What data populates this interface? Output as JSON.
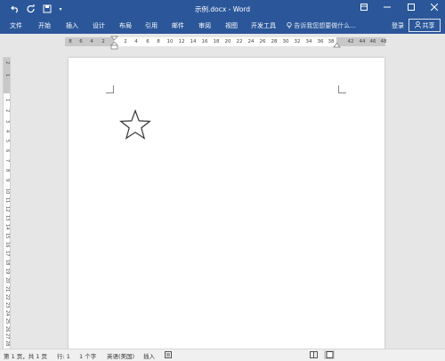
{
  "titlebar": {
    "title": "示例.docx - Word",
    "qa_undo_icon": "undo-icon",
    "qa_redo_icon": "redo-icon",
    "qa_save_icon": "save-icon",
    "qa_more": "▾"
  },
  "ribbon": {
    "tabs": [
      "文件",
      "开始",
      "插入",
      "设计",
      "布局",
      "引用",
      "邮件",
      "审阅",
      "视图",
      "开发工具"
    ],
    "tell_me": "告诉我您想要做什么...",
    "login": "登录",
    "share": "共享"
  },
  "ruler": {
    "left_ticks": [
      "8",
      "6",
      "4",
      "2"
    ],
    "right_ticks": [
      "2",
      "4",
      "6",
      "8",
      "10",
      "12",
      "14",
      "16",
      "18",
      "20",
      "22",
      "24",
      "26",
      "28",
      "30",
      "32",
      "34",
      "36",
      "38"
    ],
    "far_ticks": [
      "42",
      "44",
      "46",
      "48"
    ]
  },
  "vruler": {
    "ticks": [
      "2",
      "1",
      "1",
      "2",
      "3",
      "4",
      "5",
      "6",
      "7",
      "8",
      "9",
      "10",
      "11",
      "12",
      "13",
      "14",
      "15",
      "16",
      "17",
      "18",
      "19",
      "20",
      "21",
      "22",
      "23",
      "24",
      "25",
      "26",
      "27",
      "28",
      "29",
      "30"
    ]
  },
  "document": {
    "shape": "star"
  },
  "status": {
    "page": "第 1 页，共 1 页",
    "line": "行: 1",
    "words": "1 个字",
    "language": "英语(美国)",
    "mode": "插入"
  }
}
